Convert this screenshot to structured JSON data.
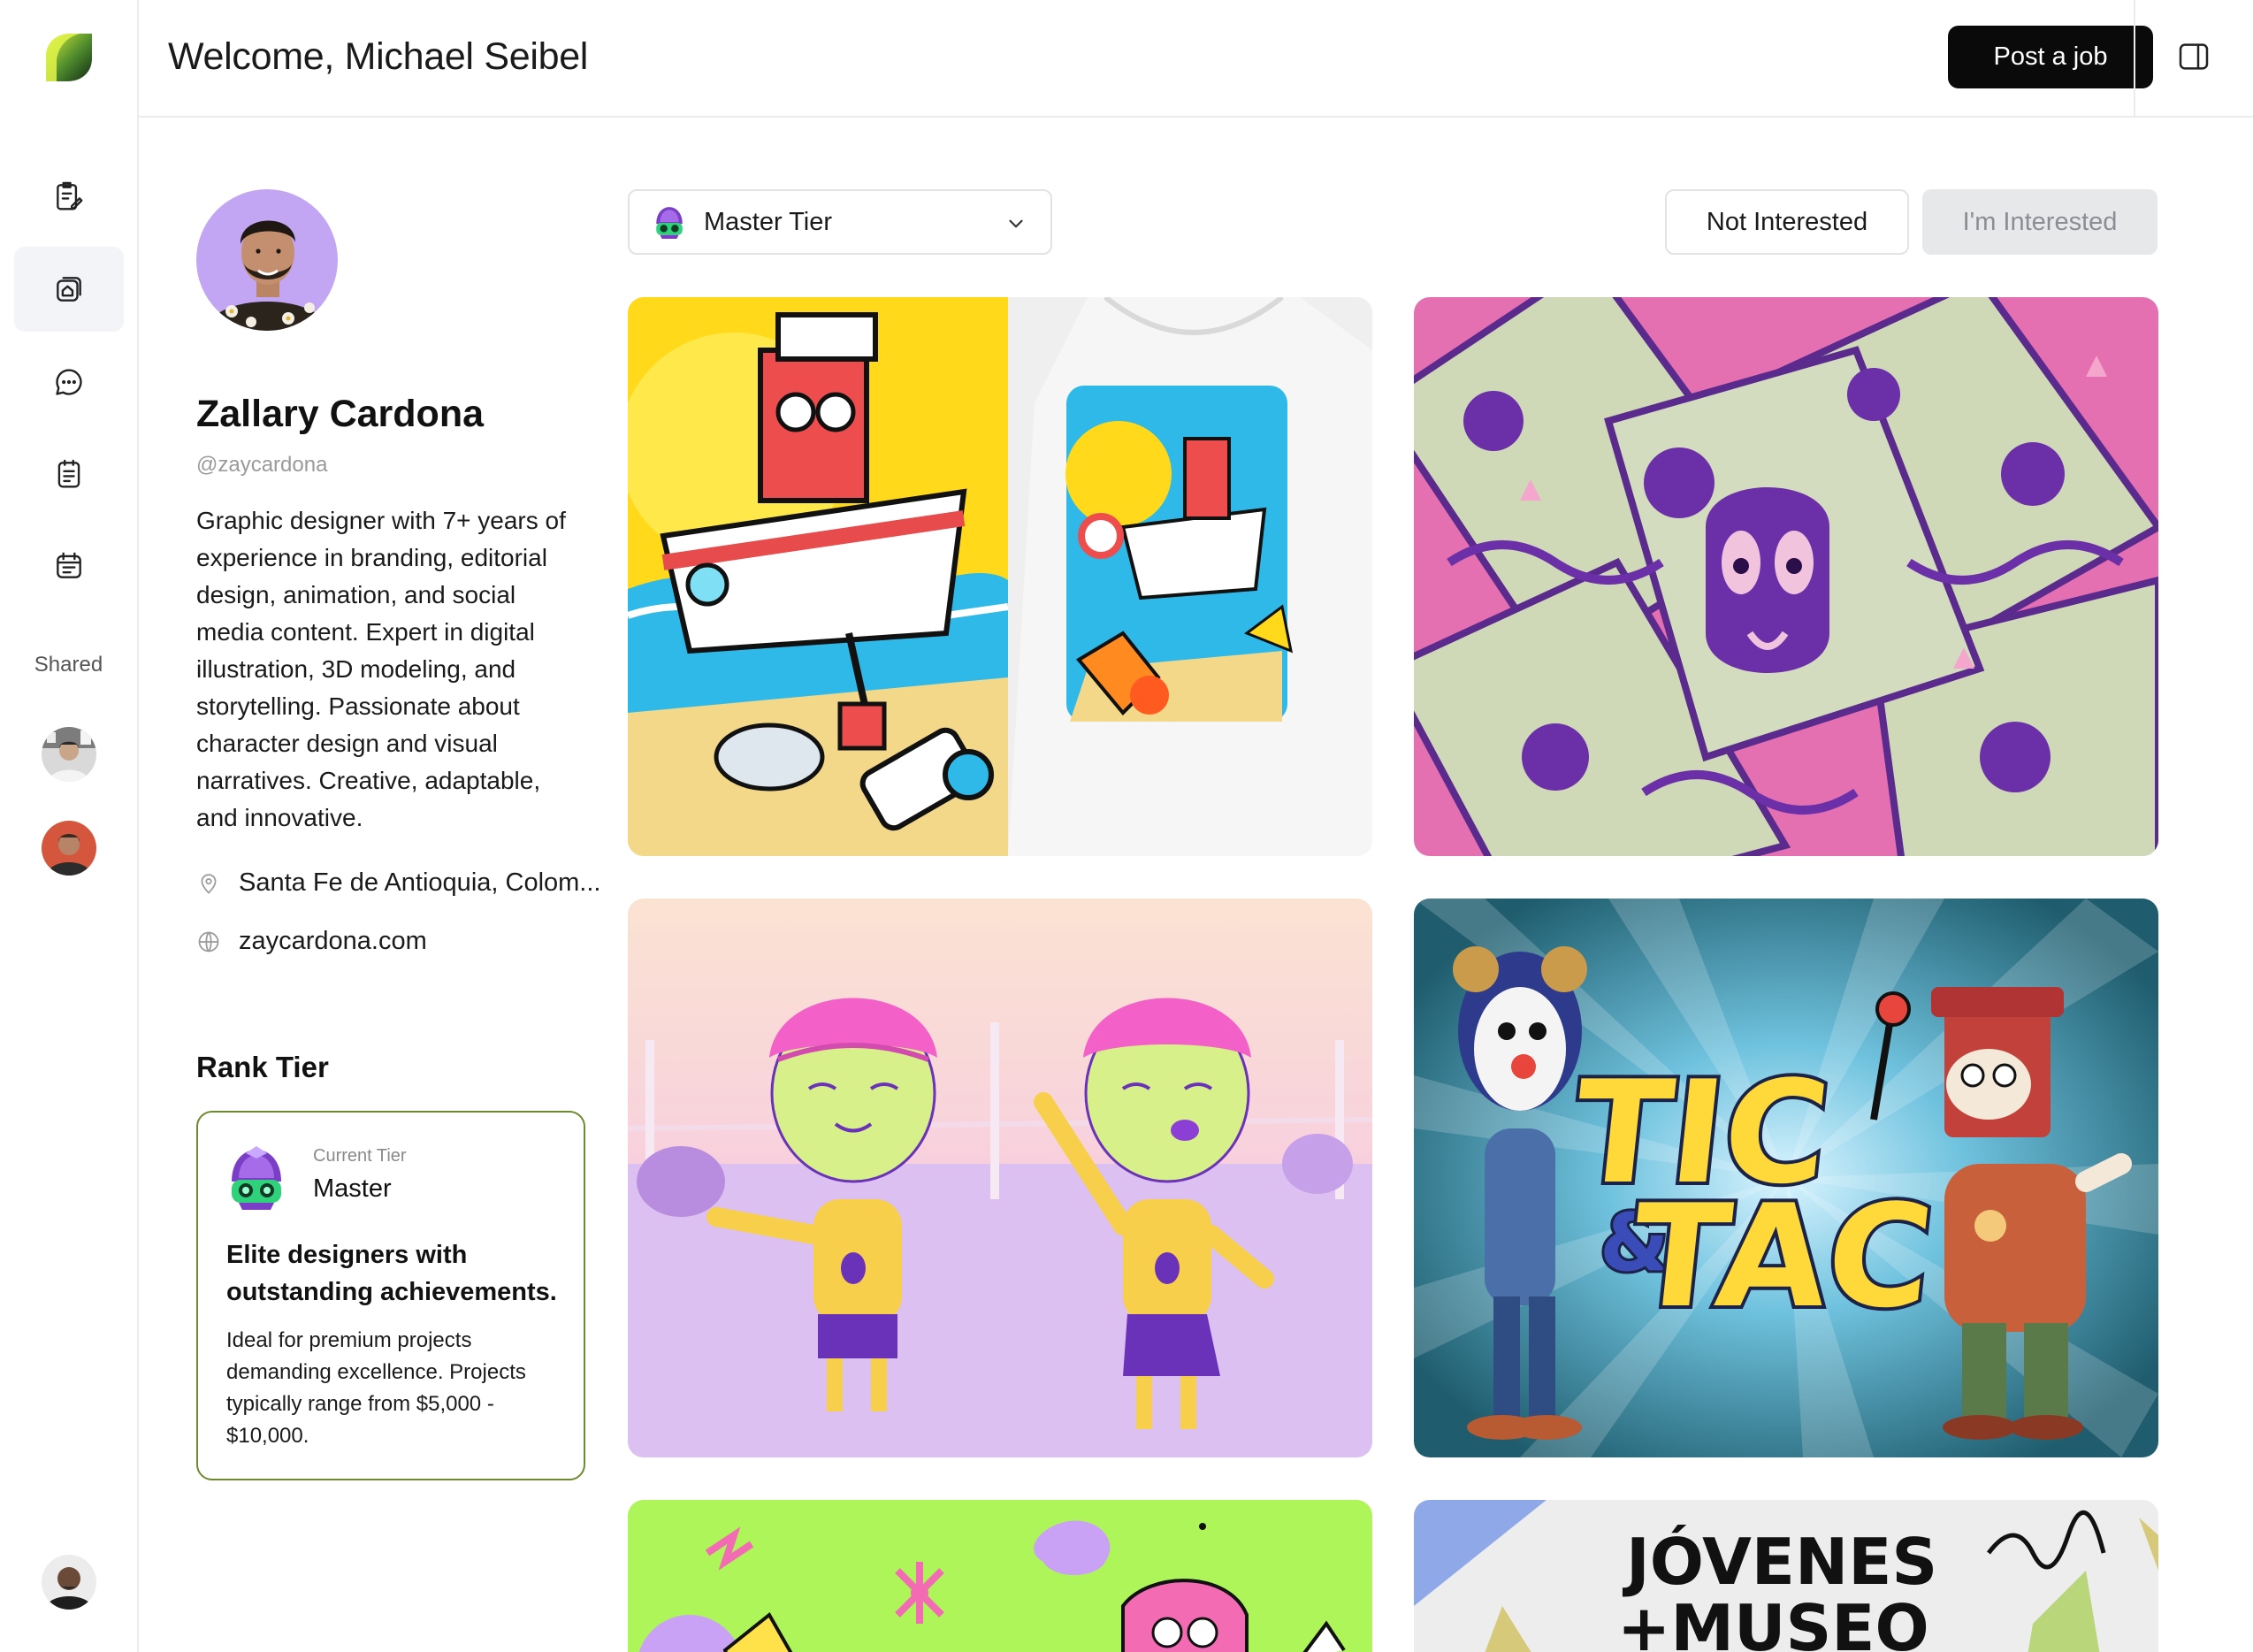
{
  "header": {
    "welcome": "Welcome, Michael Seibel",
    "post_job_label": "Post a job"
  },
  "rail": {
    "nav_icons": [
      "edit-document-icon",
      "portfolio-icon",
      "chat-icon",
      "notes-icon",
      "calendar-icon"
    ],
    "active_index": 1,
    "shared_label": "Shared"
  },
  "profile": {
    "name": "Zallary Cardona",
    "handle": "@zaycardona",
    "bio": "Graphic designer with 7+ years of experience in branding, editorial design, animation, and social media content. Expert in digital illustration, 3D modeling, and storytelling. Passionate about character design and visual narratives. Creative, adaptable, and innovative.",
    "location": "Santa Fe de Antioquia, Colom...",
    "website": "zaycardona.com"
  },
  "rank": {
    "title": "Rank Tier",
    "current_label": "Current Tier",
    "tier_name": "Master",
    "headline": "Elite designers with outstanding achievements.",
    "description": "Ideal for premium projects demanding excellence. Projects typically range from $5,000 - $10,000."
  },
  "toolbar": {
    "tier_select_value": "Master Tier",
    "not_interested_label": "Not Interested",
    "interested_label": "I'm Interested"
  },
  "gallery": {
    "tic_tac_line1": "TIC",
    "tic_tac_amp": "&",
    "tic_tac_line2": "TAC",
    "jovenes_line1": "JÓVENES",
    "jovenes_line2": "+MUSEO"
  },
  "colors": {
    "accent_dark": "#0a0a0a",
    "tier_border": "#6e8a2f",
    "tier_avatar_bg": "#c9b3f5"
  }
}
